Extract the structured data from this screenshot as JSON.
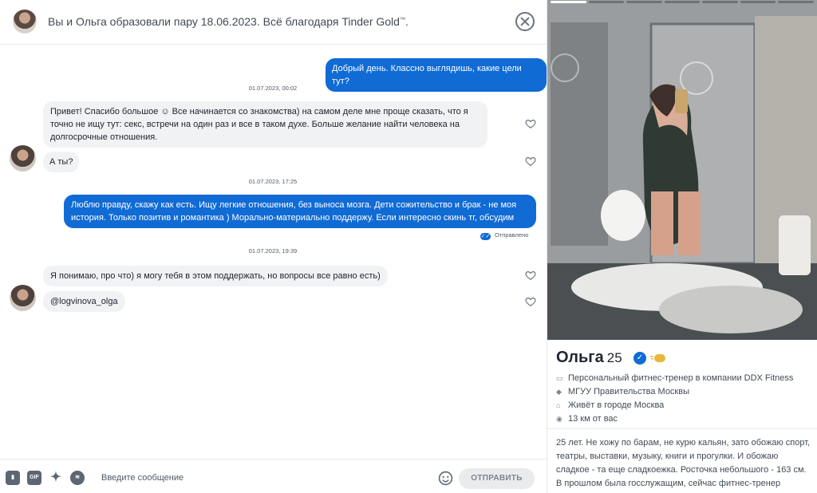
{
  "header": {
    "match_text": "Вы и Ольга образовали пару 18.06.2023. Всё благодаря",
    "gold_text": "Tinder Gold",
    "tm": "™",
    "period": "."
  },
  "messages": [
    {
      "dir": "out",
      "text": "Добрый день. Классно выглядишь, какие цели тут?"
    },
    {
      "timestamp": "01.07.2023, 00:02"
    },
    {
      "dir": "in",
      "text": "Привет! Спасибо большое ☺ Все начинается со знакомства) на самом деле мне проще сказать, что я точно не ищу тут: секс, встречи на один раз и все в таком духе. Больше желание найти человека на долгосрочные отношения."
    },
    {
      "dir": "in",
      "text": "А ты?"
    },
    {
      "timestamp": "01.07.2023, 17:25"
    },
    {
      "dir": "out",
      "text": "Люблю правду, скажу как есть. Ищу легкие отношения, без выноса мозга. Дети сожительство и брак - не моя история. Только позитив и романтика ) Морально-материально поддержу. Если интересно скинь тг, обсудим"
    },
    {
      "timestamp": "01.07.2023, 19:39"
    },
    {
      "dir": "in",
      "text": "Я понимаю, про что) я могу тебя в этом поддержать, но вопросы все равно есть)"
    },
    {
      "dir": "in",
      "text": "@logvinova_olga"
    }
  ],
  "sent_status": "Отправлено",
  "composer": {
    "placeholder": "Введите сообщение",
    "send_label": "ОТПРАВИТЬ",
    "gif_label": "GIF"
  },
  "icons": [
    "sticker-icon",
    "gif-icon",
    "sparkle-icon",
    "spotify-icon",
    "emoji-icon",
    "heart-icon",
    "close-icon",
    "verified-icon"
  ],
  "profile": {
    "name": "Ольга",
    "age": "25",
    "job": "Персональный фитнес-тренер в компании DDX Fitness",
    "school": "МГУУ Правительства Москвы",
    "lives": "Живёт в городе Москва",
    "distance": "13 км от вас",
    "bio": "25 лет. Не хожу по барам, не курю кальян, зато обожаю спорт, театры, выставки, музыку, книги и прогулки. И обожаю сладкое - та еще сладкоежка. Росточка небольшого - 163 см. В прошлом была госслужащим, сейчас фитнес-тренер"
  },
  "colors": {
    "accent": "#106bd5",
    "bubble_in": "#f0f2f4"
  }
}
